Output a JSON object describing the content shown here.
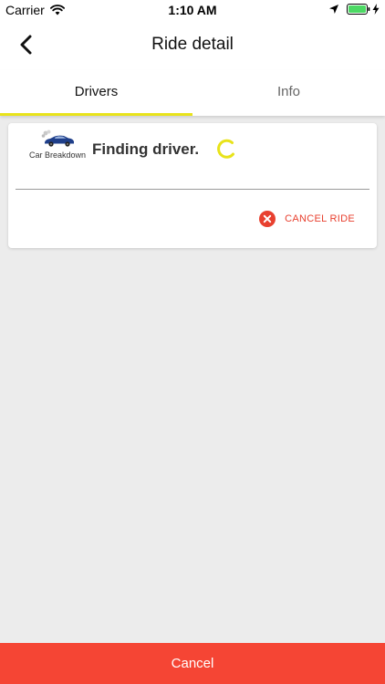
{
  "status_bar": {
    "carrier": "Carrier",
    "time": "1:10 AM",
    "icons": [
      "wifi-icon",
      "location-icon",
      "battery-icon",
      "charging-icon"
    ]
  },
  "nav": {
    "title": "Ride detail",
    "back_icon": "chevron-left-icon"
  },
  "tabs": [
    {
      "label": "Drivers",
      "active": true
    },
    {
      "label": "Info",
      "active": false
    }
  ],
  "ride_card": {
    "service_label": "Car Breakdown",
    "service_icon": "car-icon",
    "status_text": "Finding driver.",
    "cancel_ride_label": "CANCEL RIDE",
    "cancel_icon": "close-circle-icon"
  },
  "bottom_button": {
    "label": "Cancel"
  },
  "colors": {
    "accent_yellow": "#e8e31a",
    "danger_red": "#f54534",
    "cancel_text_red": "#e8402f",
    "background": "#ececec"
  }
}
